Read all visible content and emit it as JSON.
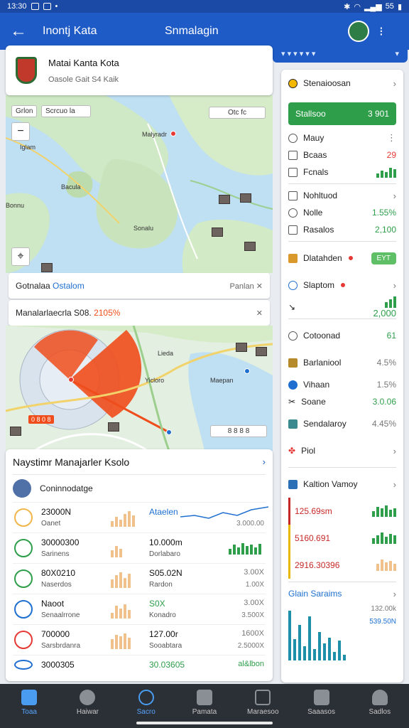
{
  "status_bar": {
    "time": "13:30",
    "battery": "55"
  },
  "app_bar": {
    "title": "Inontj Kata",
    "center_title": "Snmalagin",
    "back_icon": "arrow-left-icon",
    "more_icon": "more-icon"
  },
  "top_strip": {
    "left": "▾ ▾ ▾ ▾ ▾ ▾",
    "right": "▾"
  },
  "location_card": {
    "title": "Matai Kanta Kota",
    "subtitle": "Oasole Gait  S4 Kaik"
  },
  "map_top": {
    "chip_left": "Grlon",
    "chip_search": "Scrcuo la",
    "chip_right": "Otc  fc",
    "label_1": "Malyradr",
    "label_2": "Iglam",
    "label_3": "Bacula",
    "label_4": "Sonalu",
    "label_5": "Bonnu"
  },
  "panel_1": {
    "label": "Gotnalaa",
    "link": "Ostalom",
    "right": "Panlan"
  },
  "panel_2": {
    "label": "Manalarlaecrla S08.",
    "accent": "2105%"
  },
  "map_bottom": {
    "label_1": "Lieda",
    "label_2": "Maepan",
    "label_3": "Yicloro",
    "orange_badge": "0 8 0 8",
    "right_chip": "8  8 8 8"
  },
  "bottom_card": {
    "header": "Naystimr Manajarler Ksolo",
    "subheader": "Coninnodatge",
    "rows": [
      {
        "value": "23000N",
        "label": "Oanet",
        "value2": "Ataelen",
        "right1": "",
        "right2": "3.000.00"
      },
      {
        "value": "30000300",
        "label": "Sarinens",
        "value2": "10.000m",
        "label2": "Dorlabaro",
        "right1": "",
        "right2": ""
      },
      {
        "value": "80X0210",
        "label": "Naserdos",
        "value2": "S05.02N",
        "label2": "Rardon",
        "right1": "3.00X",
        "right2": "1.00X"
      },
      {
        "value": "Naoot",
        "label": "Senaalrrone",
        "value2": "S0X",
        "label2": "Konadro",
        "right1": "3.00X",
        "right2": "3.500X"
      },
      {
        "value": "700000",
        "label": "Sarsbrdanra",
        "value2": "127.00r",
        "label2": "Sooabtara",
        "right1": "1600X",
        "right2": "2.5000X"
      },
      {
        "value": "3000305",
        "label": "",
        "value2": "30.03605",
        "label2": "",
        "right1": "",
        "right2": "al&lbon"
      }
    ]
  },
  "side_panel": {
    "header": "Stenaioosan",
    "green_btn": {
      "label": "Stallsoo",
      "value": "3 901"
    },
    "group1": [
      {
        "label": "Mauy",
        "value": ""
      },
      {
        "label": "Bcaas",
        "value": "29"
      },
      {
        "label": "Fcnals",
        "value": ""
      }
    ],
    "group2": [
      {
        "label": "Nohltuod",
        "value": ""
      },
      {
        "label": "Nolle",
        "value": "1.55%"
      },
      {
        "label": "Rasalos",
        "value": "2,100"
      }
    ],
    "dlatahden": {
      "label": "Dlatahden",
      "badge": "EYT"
    },
    "slaptom": {
      "label": "Slaptom",
      "value": "2,000"
    },
    "cotoonad": {
      "label": "Cotoonad",
      "value": "61"
    },
    "barlbol": {
      "label": "Barlaniool",
      "value": "4.5%"
    },
    "vihaan": {
      "label": "Vihaan",
      "value": "1.5%"
    },
    "soane": {
      "label": "Soane",
      "value": "3.0.06"
    },
    "sendalay": {
      "label": "Sendalaroy",
      "value": "4.45%"
    },
    "piol": {
      "label": "Piol"
    },
    "kaltion": {
      "label": "Kaltion Vamoy"
    },
    "kaltion_rows": [
      "125.69sm",
      "5160.691",
      "2916.30396"
    ],
    "glain": {
      "label": "Glain Saraims",
      "v1": "132.00k",
      "v2": "539.50N"
    }
  },
  "nav": {
    "items": [
      {
        "label": "Toaa",
        "icon": "home-icon"
      },
      {
        "label": "Haiwar",
        "icon": "globe-icon"
      },
      {
        "label": "Sacro",
        "icon": "search-icon"
      },
      {
        "label": "Pamata",
        "icon": "map-icon"
      },
      {
        "label": "Maraesoo",
        "icon": "book-icon"
      },
      {
        "label": "Saaasos",
        "icon": "person-icon"
      },
      {
        "label": "Sadlos",
        "icon": "profile-icon"
      }
    ]
  },
  "colors": {
    "primary": "#1e5bc6",
    "accent_green": "#2e9e4a",
    "accent_red": "#e53935",
    "accent_orange": "#f04d1c"
  }
}
